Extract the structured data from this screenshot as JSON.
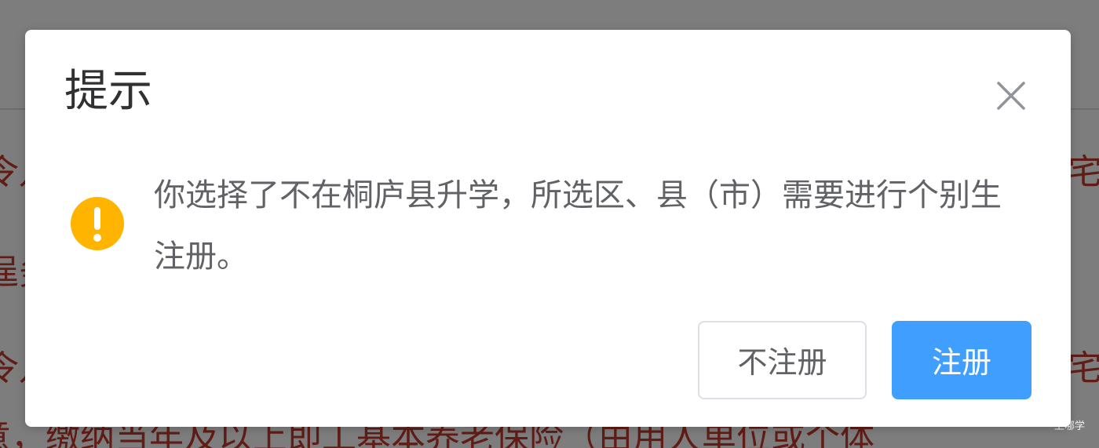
{
  "dialog": {
    "title": "提示",
    "message": "你选择了不在桐庐县升学，所选区、县（市）需要进行个别生注册。",
    "cancel_label": "不注册",
    "confirm_label": "注册",
    "close_icon": "close-icon",
    "status_icon": "warning-icon"
  },
  "background": {
    "line1": "令儿",
    "line2": "逞务",
    "line3": "令儿",
    "line4": "意，缴纳当年及以上即工基本养老保险（由用人单位或个体",
    "right1": "宅",
    "right2": "宅"
  },
  "watermark": "上哪学",
  "colors": {
    "primary": "#409eff",
    "warning": "#ffb400",
    "overlay": "rgba(0,0,0,0.5)",
    "background_text": "#c0392b"
  }
}
